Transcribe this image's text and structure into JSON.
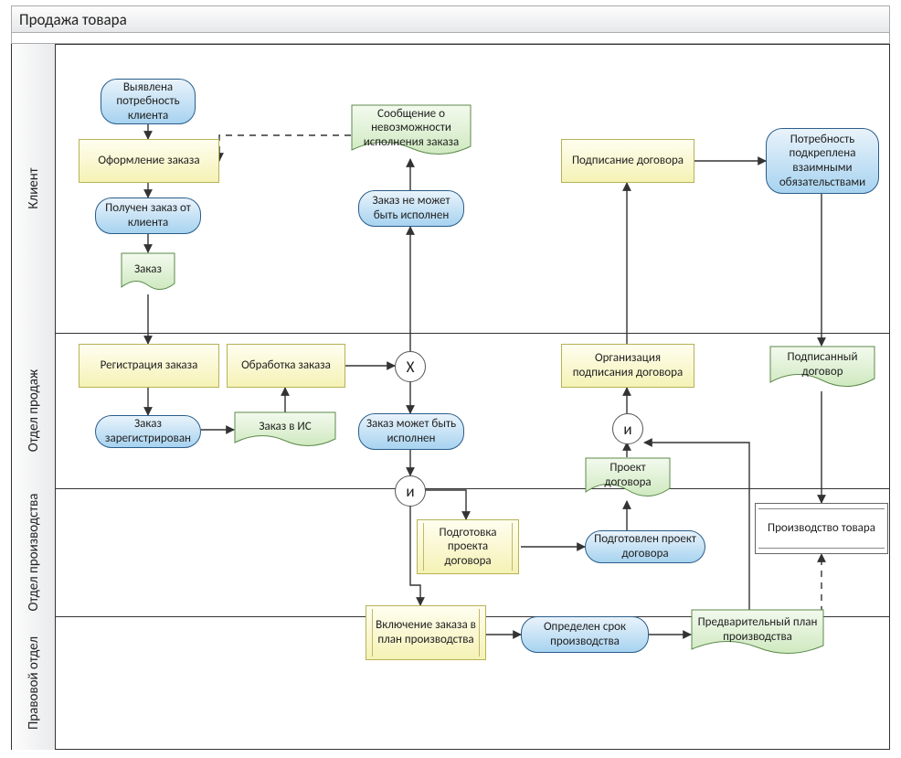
{
  "title": "Продажа товара",
  "lanes": {
    "l1": "Клиент",
    "l2": "Отдел продаж",
    "l3": "Отдел производства",
    "l4": "Правовой отдел"
  },
  "nodes": {
    "ev_need": "Выявлена потребность клиента",
    "act_order": "Оформление заказа",
    "ev_order_rcv": "Получен заказ от клиента",
    "doc_order": "Заказ",
    "act_reg": "Регистрация заказа",
    "ev_reg": "Заказ зарегистрирован",
    "doc_order_is": "Заказ в ИС",
    "act_proc": "Обработка заказа",
    "gate_x": "X",
    "ev_can": "Заказ может быть исполнен",
    "ev_cannot": "Заказ не может быть исполнен",
    "doc_msg": "Сообщение о невозможности исполнения заказа",
    "gate_and1": "и",
    "act_prep": "Подготовка проекта договора",
    "ev_prep": "Подготовлен проект договора",
    "doc_proj": "Проект договора",
    "act_plan": "Включение заказа в план производства",
    "ev_term": "Определен срок производства",
    "doc_plan": "Предварительный план производства",
    "gate_and2": "и",
    "act_org": "Организация подписания договора",
    "act_sign": "Подписание договора",
    "ev_obl": "Потребность подкреплена взаимными обязательствами",
    "doc_signed": "Подписанный договор",
    "sub_prod": "Производство товара"
  }
}
